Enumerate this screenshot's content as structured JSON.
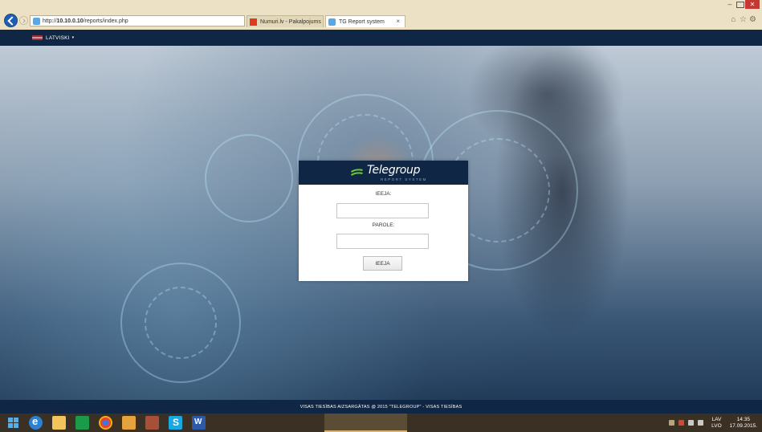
{
  "browser": {
    "url_prefix": "http://",
    "url_host": "10.10.0.10",
    "url_path": "/reports/index.php",
    "tabs": [
      {
        "label": "Numuri.lv - Pakalpojums"
      },
      {
        "label": "TG Report system"
      }
    ],
    "tab_close": "×",
    "search_icon": "⌕",
    "refresh_icon": "↻"
  },
  "topbar": {
    "language": "LATVISKI",
    "caret": "▾"
  },
  "login": {
    "brand_name": "Telegroup",
    "brand_sub": "REPORT SYSTEM",
    "user_label": "IEEJA:",
    "user_value": "",
    "pass_label": "PAROLE:",
    "pass_value": "",
    "submit_label": "IEEJA"
  },
  "footer": {
    "text": "VISAS TIESĪBAS AIZSARGĀTAS @ 2015 \"TELEGROUP\" - VISAS TIESĪBAS"
  },
  "taskbar": {
    "tray_lang_top": "LAV",
    "tray_lang_bottom": "LVO",
    "clock_time": "14:35",
    "clock_date": "17.09.2015."
  },
  "colors": {
    "navy": "#0f2644",
    "close_red": "#c7372f"
  }
}
